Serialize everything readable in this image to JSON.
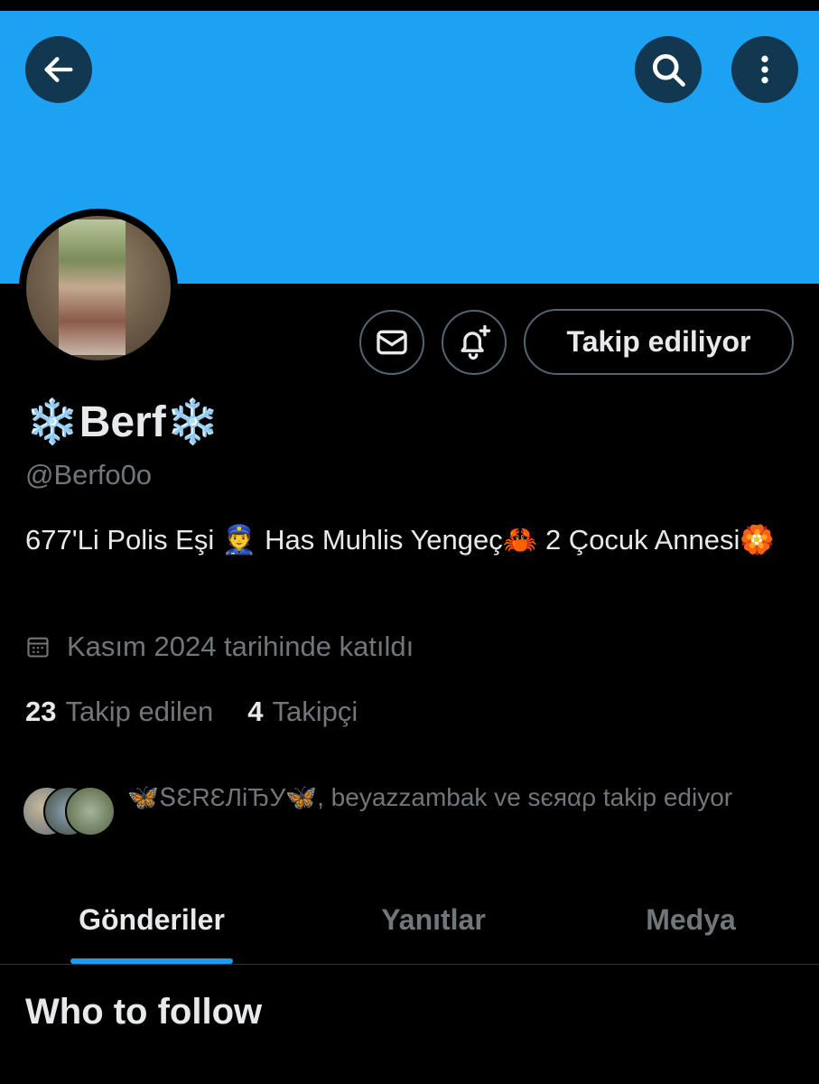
{
  "colors": {
    "banner": "#1da1f2",
    "accent": "#1d9bf0",
    "secondary_text": "#71767b",
    "primary_text": "#e7e9ea",
    "border": "#536471"
  },
  "header": {
    "back_icon": "arrow-left-icon",
    "search_icon": "search-icon",
    "more_icon": "more-vertical-icon"
  },
  "actions": {
    "message_icon": "envelope-icon",
    "notify_icon": "bell-plus-icon",
    "follow_label": "Takip ediliyor"
  },
  "profile": {
    "name": "❄️Berf❄️",
    "handle": "@Berfo0o",
    "bio": "677'Li Polis Eşi 👮  Has Muhlis Yengeç🦀 2 Çocuk Annesi🏵️",
    "joined": "Kasım 2024 tarihinde katıldı",
    "following_count": "23",
    "following_label": "Takip edilen",
    "followers_count": "4",
    "followers_label": "Takipçi"
  },
  "mutuals": {
    "text": "🦋ՏƐRƐЛiЂУ🦋, beyazzambak ve sєяαρ takip ediyor"
  },
  "tabs": [
    {
      "label": "Gönderiler",
      "active": true
    },
    {
      "label": "Yanıtlar",
      "active": false
    },
    {
      "label": "Medya",
      "active": false
    }
  ],
  "section": {
    "title": "Who to follow"
  }
}
